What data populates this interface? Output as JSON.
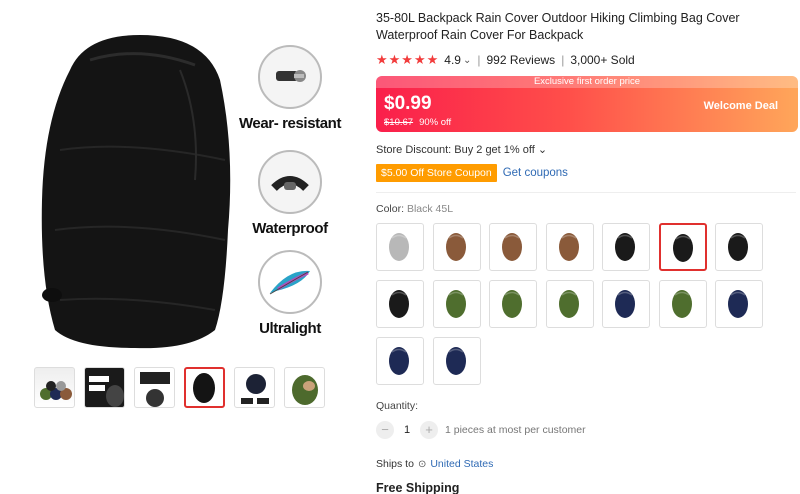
{
  "gallery": {
    "features": [
      {
        "label": "Wear- resistant",
        "icon": "zipper-icon"
      },
      {
        "label": "Waterproof",
        "icon": "drawstring-icon"
      },
      {
        "label": "Ultralight",
        "icon": "feather-icon"
      }
    ],
    "thumbnails": [
      {
        "color": "#6b7a3a"
      },
      {
        "color": "#1a1a1a"
      },
      {
        "color": "#222"
      },
      {
        "color": "#111",
        "active": true
      },
      {
        "color": "#1c2235"
      },
      {
        "color": "#4d6a2d"
      }
    ]
  },
  "product": {
    "title": "35-80L Backpack Rain Cover Outdoor Hiking Climbing Bag Cover Waterproof Rain Cover For Backpack",
    "stars": "★★★★★",
    "rating": "4.9",
    "rating_chevron": "⌄",
    "reviews": "992 Reviews",
    "sold": "3,000+ Sold"
  },
  "price": {
    "banner": "Exclusive first order price",
    "current": "$0.99",
    "original": "$10.67",
    "discount": "90% off",
    "deal_label": "Welcome Deal"
  },
  "store": {
    "discount_text": "Store Discount: Buy 2 get 1% off ⌄",
    "coupon": "$5.00 Off Store Coupon",
    "get_coupons": "Get coupons"
  },
  "color": {
    "label": "Color:",
    "selected": "Black 45L",
    "swatches": [
      {
        "name": "silver",
        "hex": "#b8b8b8"
      },
      {
        "name": "brown",
        "hex": "#8a5a3a"
      },
      {
        "name": "brown",
        "hex": "#8a5a3a"
      },
      {
        "name": "brown",
        "hex": "#8a5a3a"
      },
      {
        "name": "black",
        "hex": "#1a1a1a"
      },
      {
        "name": "black",
        "hex": "#1a1a1a",
        "active": true
      },
      {
        "name": "black",
        "hex": "#1a1a1a"
      },
      {
        "name": "black",
        "hex": "#1a1a1a"
      },
      {
        "name": "green",
        "hex": "#4f6e2e"
      },
      {
        "name": "green",
        "hex": "#4f6e2e"
      },
      {
        "name": "green",
        "hex": "#4f6e2e"
      },
      {
        "name": "navy",
        "hex": "#1e2a55"
      },
      {
        "name": "green",
        "hex": "#4f6e2e"
      },
      {
        "name": "navy",
        "hex": "#1e2a55"
      },
      {
        "name": "navy",
        "hex": "#1e2a55"
      },
      {
        "name": "navy",
        "hex": "#1e2a55"
      }
    ]
  },
  "quantity": {
    "label": "Quantity:",
    "minus": "−",
    "value": "1",
    "plus": "+",
    "note": "1 pieces at most per customer"
  },
  "shipping": {
    "ships_to": "Ships to",
    "pin": "⊙",
    "destination": "United States",
    "free": "Free Shipping"
  },
  "colors": {
    "accent": "#e0302e",
    "link": "#2f6ab4",
    "coupon": "#ff9c00",
    "star": "#f23c3c"
  }
}
